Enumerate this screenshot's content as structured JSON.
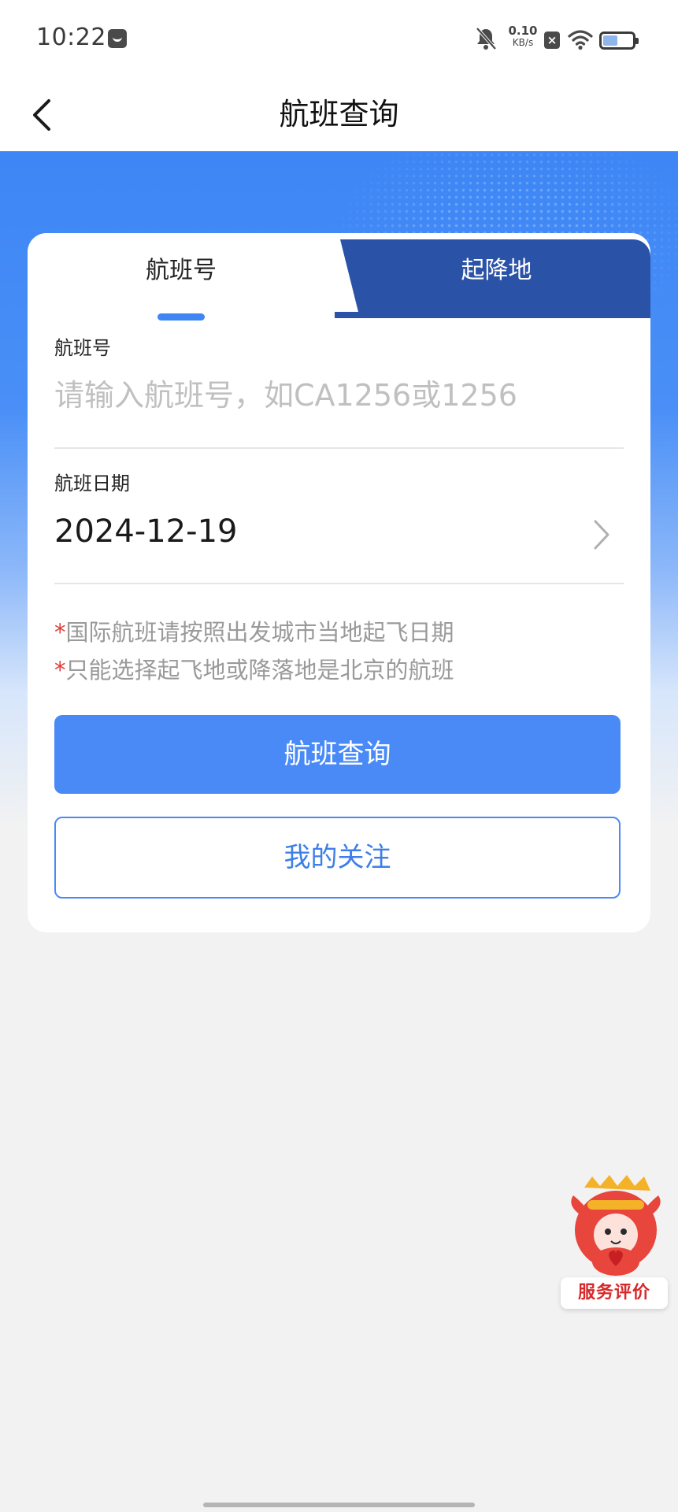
{
  "status_bar": {
    "time": "10:22",
    "net_speed_value": "0.10",
    "net_speed_unit": "KB/s",
    "battery_level": 0.5,
    "icons": [
      "message-icon",
      "mute-icon",
      "box-x-icon",
      "wifi-icon",
      "battery-icon"
    ]
  },
  "header": {
    "title": "航班查询",
    "back_icon": "chevron-left-icon"
  },
  "tabs": [
    {
      "label": "航班号",
      "active": true
    },
    {
      "label": "起降地",
      "active": false
    }
  ],
  "form": {
    "flight_no_label": "航班号",
    "flight_no_placeholder": "请输入航班号，如CA1256或1256",
    "flight_no_value": "",
    "date_label": "航班日期",
    "date_value": "2024-12-19",
    "date_icon": "chevron-right-icon"
  },
  "notes": [
    {
      "star": "*",
      "text": "国际航班请按照出发城市当地起飞日期"
    },
    {
      "star": "*",
      "text": "只能选择起飞地或降落地是北京的航班"
    }
  ],
  "buttons": {
    "query_label": "航班查询",
    "follow_label": "我的关注"
  },
  "floating": {
    "label": "服务评价"
  },
  "colors": {
    "primary": "#4a8af6",
    "tab_inactive": "#2a52a6",
    "note_star": "#e23a3a",
    "note_text": "#9a9a9a",
    "background": "#f2f2f2"
  }
}
